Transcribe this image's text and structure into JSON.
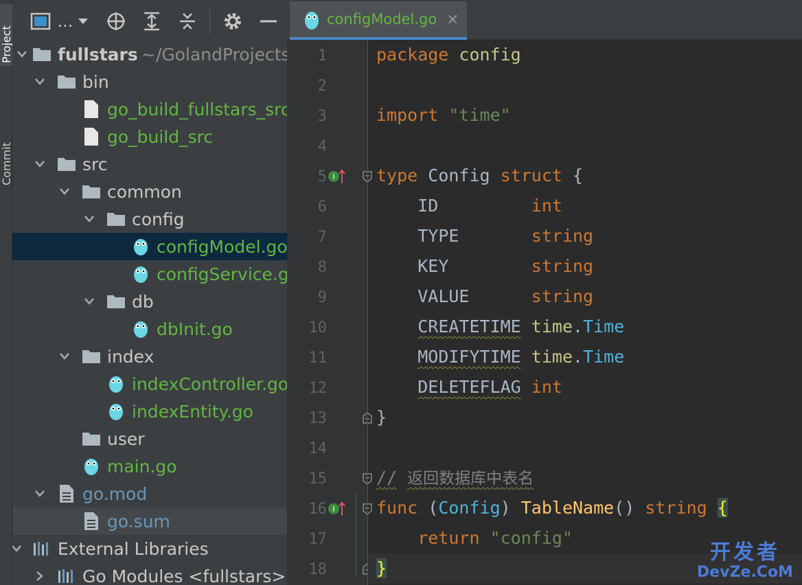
{
  "side_strip": {
    "project_label": "Project",
    "commit_label": "Commit"
  },
  "toolbar": {
    "view_label": "..."
  },
  "tree": {
    "root_name": "fullstars",
    "root_path": "~/GolandProjects/fullstars",
    "bin": "bin",
    "bin_file_1": "go_build_fullstars_src",
    "bin_file_2": "go_build_src",
    "src": "src",
    "common": "common",
    "config": "config",
    "config_file_1": "configModel.go",
    "config_file_2": "configService.go",
    "db": "db",
    "db_file": "dbInit.go",
    "index": "index",
    "index_file_1": "indexController.go",
    "index_file_2": "indexEntity.go",
    "user": "user",
    "main_file": "main.go",
    "go_mod": "go.mod",
    "go_sum": "go.sum",
    "external_libraries": "External Libraries",
    "go_modules": "Go Modules <fullstars>"
  },
  "editor": {
    "tab_label": "configModel.go",
    "tab_close": "×",
    "line_numbers": [
      "1",
      "2",
      "3",
      "4",
      "5",
      "6",
      "7",
      "8",
      "9",
      "10",
      "11",
      "12",
      "13",
      "14",
      "15",
      "16",
      "17",
      "18"
    ],
    "code": {
      "l1_kw": "package",
      "l1_name": "config",
      "l3_kw": "import",
      "l3_str": "\"time\"",
      "l5_kw": "type",
      "l5_name": "Config",
      "l5_kw2": "struct",
      "l5_brace": "{",
      "fields": [
        {
          "name": "ID",
          "pad": "         ",
          "type": "int"
        },
        {
          "name": "TYPE",
          "pad": "       ",
          "type": "string"
        },
        {
          "name": "KEY",
          "pad": "        ",
          "type": "string"
        },
        {
          "name": "VALUE",
          "pad": "      ",
          "type": "string"
        }
      ],
      "l10_name": "CREATETIME",
      "l10_pkg": "time",
      "l10_type": "Time",
      "l11_name": "MODIFYTIME",
      "l11_pkg": "time",
      "l11_type": "Time",
      "l12_name": "DELETEFLAG",
      "l12_type": "int",
      "l13_brace": "}",
      "l15_comment_slashes": "//",
      "l15_comment_text": "返回数据库中表名",
      "l16_kw": "func",
      "l16_recv": "Config",
      "l16_fn": "TableName",
      "l16_ret": "string",
      "l16_brace": "{",
      "l17_kw": "return",
      "l17_str": "\"config\"",
      "l18_brace": "}"
    }
  },
  "watermark": {
    "top": "开发者",
    "bottom": "DevZe.CoM"
  },
  "colors": {
    "accent": "#4a88c7",
    "green_file": "#62b543",
    "keyword": "#cc7832",
    "string": "#6a8759",
    "function": "#ffc66d"
  }
}
